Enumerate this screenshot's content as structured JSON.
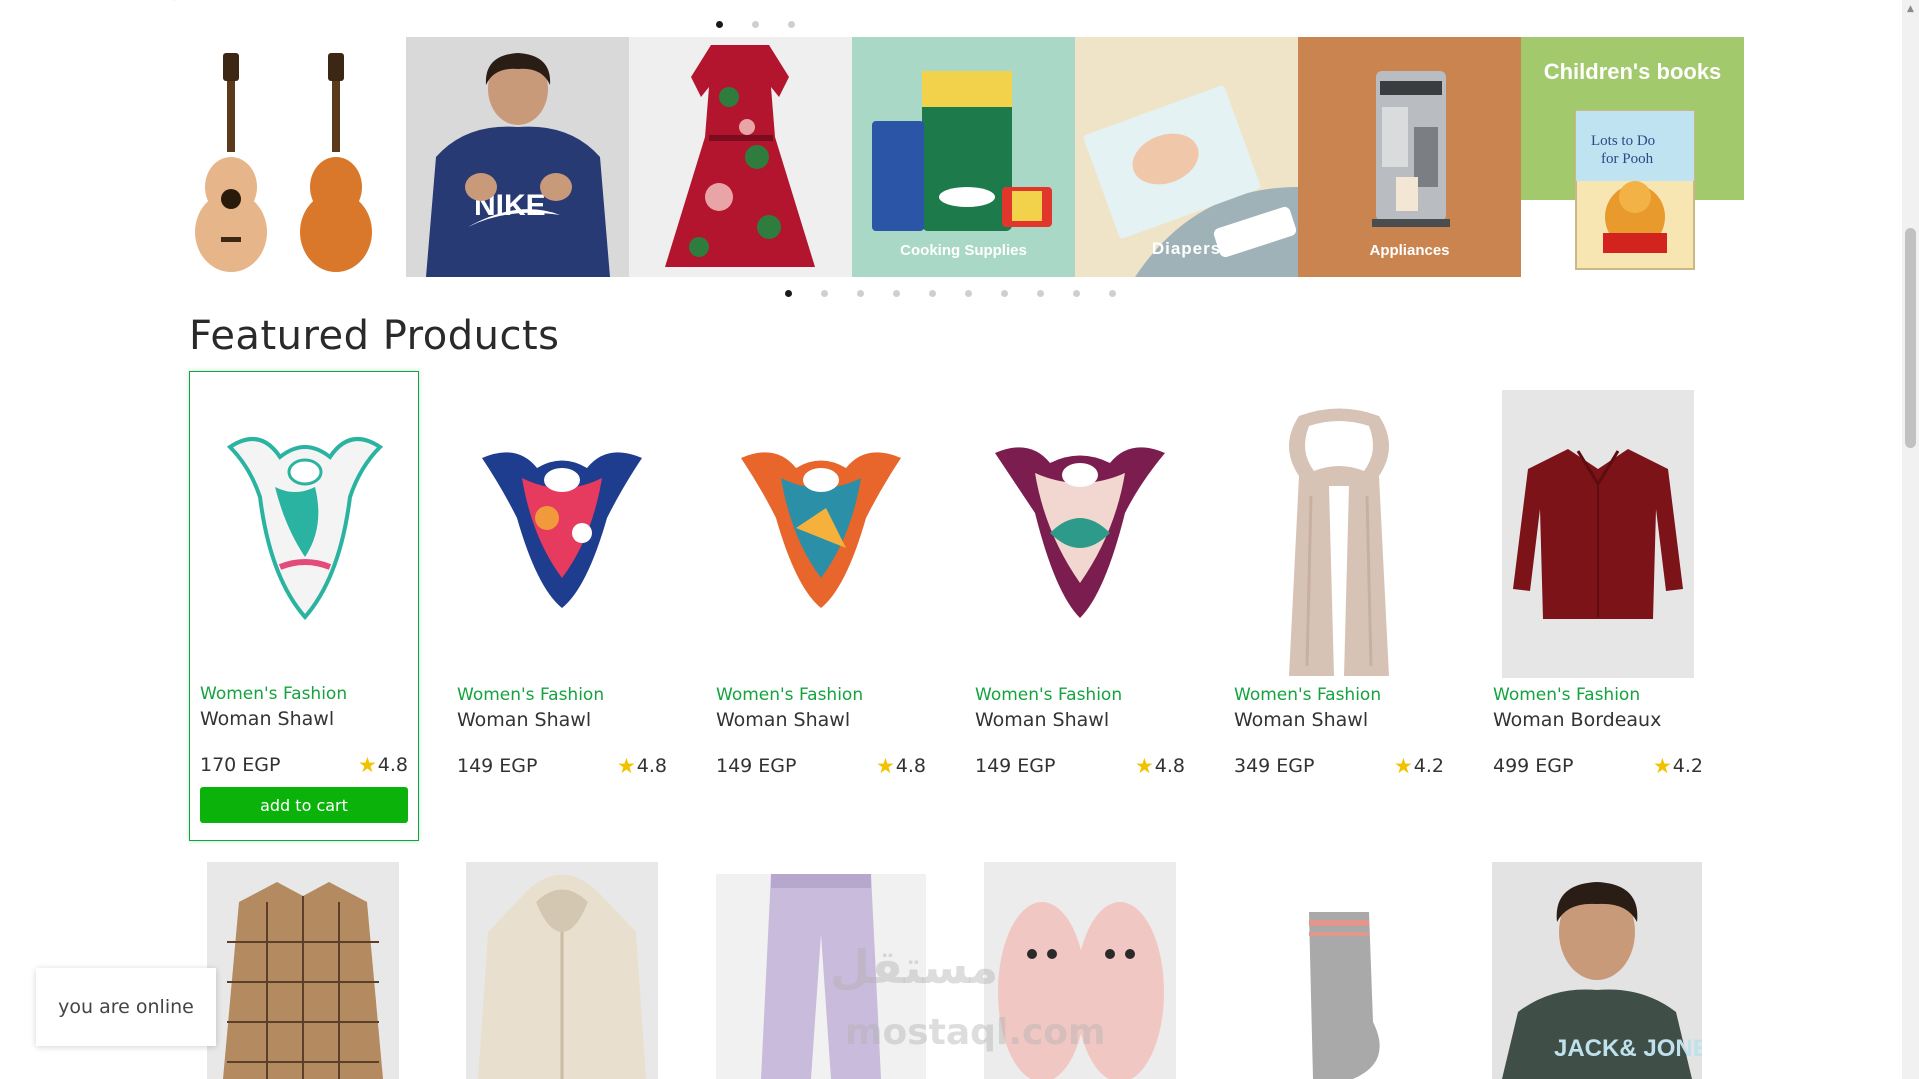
{
  "slider": {
    "top_dots": [
      true,
      false,
      false
    ],
    "bottom_dots": [
      true,
      false,
      false,
      false,
      false,
      false,
      false,
      false,
      false,
      false
    ],
    "slides": [
      {
        "label": "",
        "icon": "guitar-icon"
      },
      {
        "label": "",
        "icon": "hoodie-icon"
      },
      {
        "label": "",
        "icon": "dress-icon"
      },
      {
        "label": "Cooking Supplies",
        "icon": "grocery-icon",
        "color": "#a9d8c6"
      },
      {
        "label": "Diapers",
        "icon": "diapers-icon",
        "color": "#9fb2b8"
      },
      {
        "label": "Appliances",
        "icon": "coffee-machine-icon",
        "color": "#c9844f"
      },
      {
        "title": "Children's books",
        "icon": "book-icon",
        "color": "#a3c96d"
      }
    ]
  },
  "section_title": "Featured Products",
  "products": [
    {
      "category": "Women's Fashion",
      "name": "Woman Shawl",
      "price": "170 EGP",
      "rating": "4.8",
      "button": "add to cart",
      "icon": "scarf-icon",
      "colors": [
        "#2ab3a0",
        "#f0f0f0",
        "#e24b7a"
      ]
    },
    {
      "category": "Women's Fashion",
      "name": "Woman Shawl",
      "price": "149 EGP",
      "rating": "4.8",
      "icon": "scarf-icon",
      "colors": [
        "#1f3d8f",
        "#e63a5e",
        "#f29a3b"
      ]
    },
    {
      "category": "Women's Fashion",
      "name": "Woman Shawl",
      "price": "149 EGP",
      "rating": "4.8",
      "icon": "scarf-icon",
      "colors": [
        "#e8662c",
        "#2b8fa8",
        "#f5b13b"
      ]
    },
    {
      "category": "Women's Fashion",
      "name": "Woman Shawl",
      "price": "149 EGP",
      "rating": "4.8",
      "icon": "scarf-icon",
      "colors": [
        "#7b1e4f",
        "#f2d7d0",
        "#2e9b8a"
      ]
    },
    {
      "category": "Women's Fashion",
      "name": "Woman Shawl",
      "price": "349 EGP",
      "rating": "4.2",
      "icon": "long-scarf-icon",
      "colors": [
        "#d7c3b6",
        "#c7b0a1",
        "#e6d6cb"
      ]
    },
    {
      "category": "Women's Fashion",
      "name": "Woman Bordeaux",
      "price": "499 EGP",
      "rating": "4.2",
      "icon": "shirt-icon",
      "colors": [
        "#7c1318",
        "#e6e6e6",
        "#5d0c10"
      ]
    }
  ],
  "row2": [
    {
      "icon": "plaid-shirt-icon",
      "color": "#b48a60"
    },
    {
      "icon": "cream-hoodie-icon",
      "color": "#e9dfcf"
    },
    {
      "icon": "lavender-pants-icon",
      "color": "#c9bbdb"
    },
    {
      "icon": "pink-slippers-icon",
      "color": "#f0c7c2"
    },
    {
      "icon": "grey-socks-icon",
      "color": "#a9a9a9"
    },
    {
      "icon": "tshirt-man-icon",
      "color": "#3f4f48"
    }
  ],
  "row2_brand_text": "JACK& JONES",
  "toast": "you are online",
  "watermark": "مستقل",
  "watermark_en": "mostaql.com"
}
